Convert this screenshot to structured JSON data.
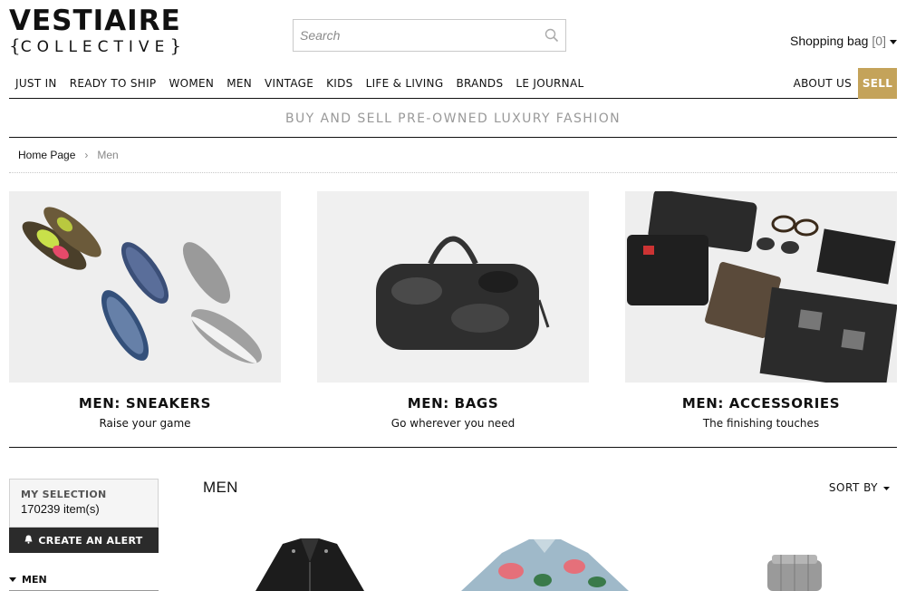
{
  "header": {
    "logo_top": "VESTIAIRE",
    "logo_bottom": "COLLECTIVE",
    "search_placeholder": "Search",
    "bag_label": "Shopping bag",
    "bag_count": "[0]"
  },
  "nav": {
    "items": [
      "JUST IN",
      "READY TO SHIP",
      "WOMEN",
      "MEN",
      "VINTAGE",
      "KIDS",
      "LIFE & LIVING",
      "BRANDS",
      "LE JOURNAL"
    ],
    "about": "ABOUT US",
    "sell": "SELL"
  },
  "tagline": "BUY AND SELL PRE-OWNED LUXURY FASHION",
  "breadcrumb": {
    "home": "Home Page",
    "separator": "›",
    "current": "Men"
  },
  "features": [
    {
      "title": "MEN: SNEAKERS",
      "subtitle": "Raise your game"
    },
    {
      "title": "MEN: BAGS",
      "subtitle": "Go wherever you need"
    },
    {
      "title": "MEN: ACCESSORIES",
      "subtitle": "The finishing touches"
    }
  ],
  "sidebar": {
    "selection_label": "MY SELECTION",
    "selection_count": "170239 item(s)",
    "alert_label": "CREATE AN ALERT",
    "filter_label": "MEN"
  },
  "listing": {
    "title": "MEN",
    "sort_label": "SORT BY"
  },
  "colors": {
    "accent": "#c4a35a",
    "dark_button": "#2b2b2b"
  }
}
